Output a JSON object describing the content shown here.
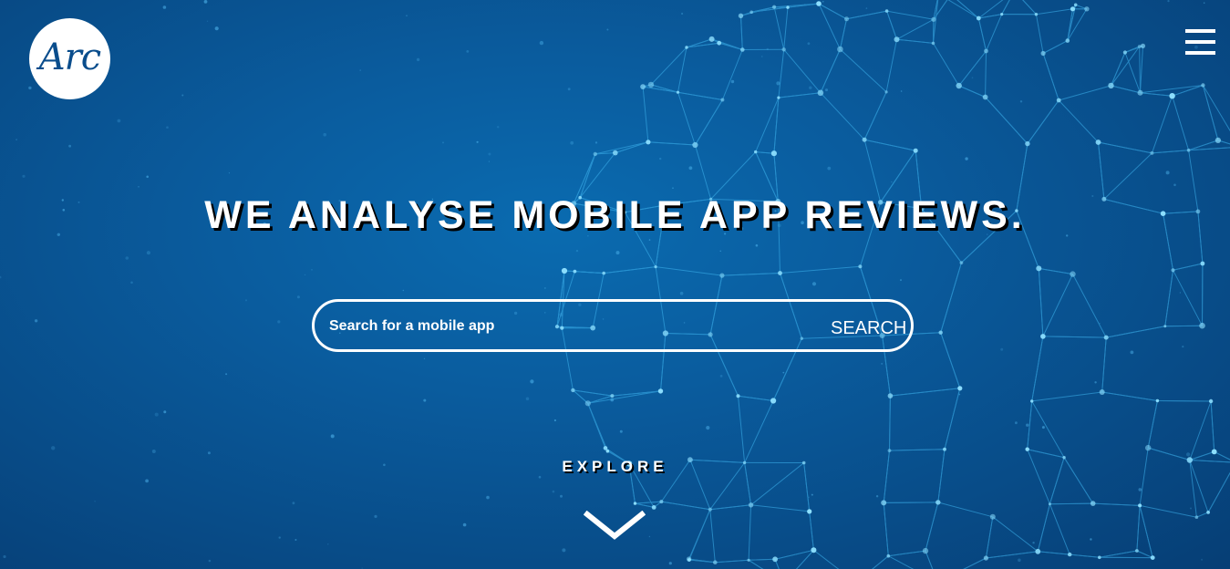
{
  "logo": {
    "text": "Arc"
  },
  "nav": {
    "menu_icon": "hamburger-menu-icon"
  },
  "hero": {
    "headline": "WE ANALYSE MOBILE APP REVIEWS.",
    "search": {
      "placeholder": "Search for a mobile app",
      "button_label": "SEARCH"
    },
    "explore_label": "EXPLORE",
    "explore_icon": "chevron-down-icon"
  },
  "colors": {
    "background": "#0a5c9e",
    "network_lines": "#3fb4ee",
    "text": "#ffffff",
    "logo_text": "#0a4d8c"
  }
}
